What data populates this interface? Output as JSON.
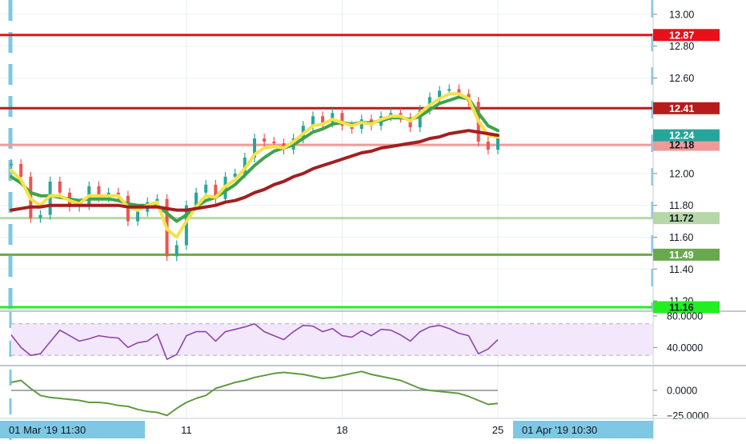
{
  "chart_data": [
    {
      "type": "line",
      "panel": "price",
      "y_axis_ticks": [
        "13.00",
        "12.80",
        "12.60",
        "12.40",
        "12.20",
        "12.00",
        "11.80",
        "11.60",
        "11.40",
        "11.20"
      ],
      "y_tick_values": [
        13.0,
        12.8,
        12.6,
        12.4,
        12.2,
        12.0,
        11.8,
        11.6,
        11.4,
        11.2
      ],
      "ylim": [
        11.14,
        13.09
      ],
      "x_tick_labels": [
        "11",
        "18",
        "25"
      ],
      "x_tick_index": [
        18,
        34,
        50
      ],
      "x_count": 51,
      "horizontal_levels": [
        {
          "label": "12.87",
          "value": 12.87,
          "color": "#e8101a"
        },
        {
          "label": "12.41",
          "value": 12.41,
          "color": "#b71c1c"
        },
        {
          "label": "12.18",
          "value": 12.18,
          "color": "#ef9a9a"
        },
        {
          "label": "11.72",
          "value": 11.72,
          "color": "#b7d7a8"
        },
        {
          "label": "11.49",
          "value": 11.49,
          "color": "#6aa84f"
        },
        {
          "label": "11.16",
          "value": 11.16,
          "color": "#22ee22"
        }
      ],
      "last_price_label": "12.24",
      "last_price_color": "#26a69a",
      "price": [
        12.06,
        11.98,
        11.72,
        11.74,
        11.95,
        11.88,
        11.79,
        11.8,
        11.92,
        11.85,
        11.88,
        11.86,
        11.7,
        11.76,
        11.82,
        11.84,
        11.48,
        11.55,
        11.8,
        11.88,
        11.93,
        11.84,
        11.98,
        12.0,
        12.1,
        12.22,
        12.2,
        12.19,
        12.15,
        12.22,
        12.3,
        12.36,
        12.32,
        12.38,
        12.3,
        12.28,
        12.34,
        12.3,
        12.36,
        12.38,
        12.35,
        12.29,
        12.4,
        12.48,
        12.52,
        12.53,
        12.5,
        12.45,
        12.2,
        12.15,
        12.22
      ],
      "series": [
        {
          "values": [
            11.98,
            11.94,
            11.88,
            11.86,
            11.86,
            11.85,
            11.84,
            11.83,
            11.84,
            11.84,
            11.84,
            11.83,
            11.81,
            11.8,
            11.8,
            11.8,
            11.75,
            11.7,
            11.74,
            11.79,
            11.83,
            11.85,
            11.89,
            11.93,
            11.99,
            12.05,
            12.1,
            12.14,
            12.16,
            12.18,
            12.22,
            12.26,
            12.28,
            12.31,
            12.32,
            12.31,
            12.32,
            12.32,
            12.33,
            12.35,
            12.35,
            12.34,
            12.36,
            12.4,
            12.44,
            12.46,
            12.48,
            12.47,
            12.38,
            12.3,
            12.27
          ],
          "color": "#3fa34d"
        },
        {
          "values": [
            12.02,
            11.96,
            11.84,
            11.8,
            11.86,
            11.86,
            11.83,
            11.81,
            11.86,
            11.86,
            11.86,
            11.86,
            11.79,
            11.77,
            11.8,
            11.82,
            11.65,
            11.6,
            11.7,
            11.79,
            11.86,
            11.85,
            11.92,
            11.96,
            12.03,
            12.12,
            12.16,
            12.17,
            12.16,
            12.2,
            12.25,
            12.3,
            12.31,
            12.34,
            12.32,
            12.3,
            12.32,
            12.31,
            12.34,
            12.36,
            12.36,
            12.33,
            12.38,
            12.43,
            12.47,
            12.5,
            12.5,
            12.47,
            12.33,
            12.24,
            12.23
          ],
          "color": "#f5e14a"
        },
        {
          "values": [
            11.77,
            11.78,
            11.79,
            11.79,
            11.8,
            11.8,
            11.8,
            11.8,
            11.8,
            11.8,
            11.8,
            11.8,
            11.79,
            11.79,
            11.79,
            11.79,
            11.78,
            11.77,
            11.77,
            11.78,
            11.79,
            11.8,
            11.82,
            11.83,
            11.85,
            11.88,
            11.9,
            11.93,
            11.95,
            11.98,
            12.0,
            12.03,
            12.05,
            12.07,
            12.09,
            12.11,
            12.13,
            12.14,
            12.16,
            12.17,
            12.18,
            12.19,
            12.2,
            12.22,
            12.23,
            12.25,
            12.26,
            12.27,
            12.26,
            12.25,
            12.24
          ],
          "color": "#a31f1f"
        }
      ]
    },
    {
      "type": "line",
      "panel": "rsi",
      "y_axis_ticks": [
        "80.0000",
        "40.0000"
      ],
      "y_tick_values": [
        80,
        40
      ],
      "ylim": [
        18,
        85
      ],
      "band": [
        30,
        70
      ],
      "color": "#8e44ad",
      "values": [
        56,
        40,
        30,
        32,
        47,
        62,
        55,
        48,
        51,
        55,
        53,
        52,
        40,
        46,
        48,
        57,
        25,
        31,
        55,
        60,
        60,
        48,
        60,
        63,
        66,
        70,
        60,
        55,
        50,
        60,
        68,
        67,
        60,
        64,
        55,
        53,
        61,
        55,
        63,
        62,
        56,
        48,
        60,
        66,
        68,
        64,
        58,
        55,
        32,
        38,
        50
      ]
    },
    {
      "type": "line",
      "panel": "oscillator",
      "y_axis_ticks": [
        "0.0000",
        "−25.0000"
      ],
      "y_tick_values": [
        0,
        -25
      ],
      "ylim": [
        -28,
        24
      ],
      "zero_line": 0,
      "color": "#5e9b3f",
      "values": [
        8,
        10,
        2,
        -5,
        -7,
        -8,
        -9,
        -10,
        -12,
        -12,
        -13,
        -15,
        -16,
        -19,
        -21,
        -22,
        -25,
        -18,
        -12,
        -8,
        -5,
        2,
        5,
        8,
        10,
        13,
        15,
        17,
        18,
        17,
        16,
        14,
        12,
        13,
        15,
        17,
        19,
        16,
        14,
        12,
        10,
        6,
        2,
        0,
        -1,
        -2,
        -3,
        -6,
        -10,
        -14,
        -13
      ]
    }
  ],
  "x_axis": {
    "start_label": "01 Mar '19   11:30",
    "end_label": "01 Apr '19   10:30",
    "tick_labels": [
      "11",
      "18",
      "25"
    ]
  }
}
